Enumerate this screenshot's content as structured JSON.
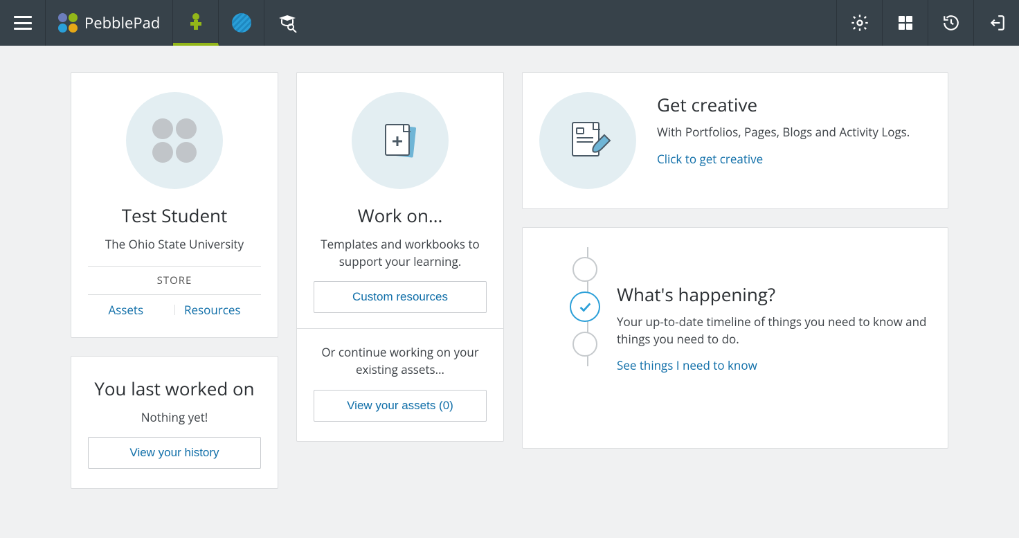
{
  "brand": {
    "name": "PebblePad"
  },
  "profile": {
    "name": "Test Student",
    "org": "The Ohio State University",
    "store_label": "STORE",
    "assets_label": "Assets",
    "resources_label": "Resources"
  },
  "last_worked": {
    "title": "You last worked on",
    "empty": "Nothing yet!",
    "history_btn": "View your history"
  },
  "work_on": {
    "title": "Work on...",
    "desc": "Templates and workbooks to support your learning.",
    "resources_btn": "Custom resources",
    "continue": "Or continue working on your existing assets...",
    "assets_btn": "View your assets (0)"
  },
  "creative": {
    "title": "Get creative",
    "desc": "With Portfolios, Pages, Blogs and Activity Logs.",
    "link": "Click to get creative"
  },
  "happening": {
    "title": "What's happening?",
    "desc": "Your up-to-date timeline of things you need to know and things you need to do.",
    "link": "See things I need to know"
  }
}
